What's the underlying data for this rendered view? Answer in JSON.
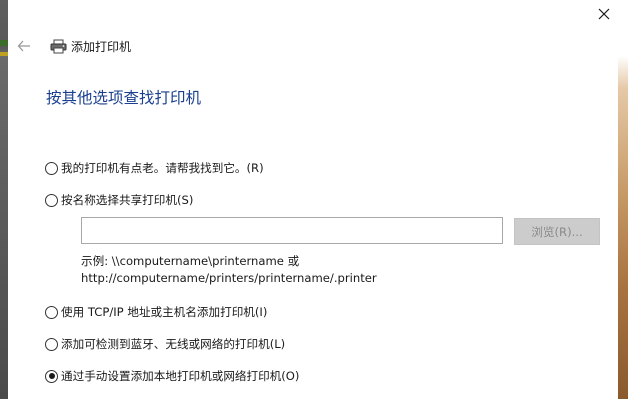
{
  "window": {
    "title": "添加打印机",
    "close_icon": "close-icon",
    "back_icon": "back-arrow-icon",
    "printer_icon": "printer-icon"
  },
  "main": {
    "heading": "按其他选项查找打印机",
    "options": [
      {
        "label": "我的打印机有点老。请帮我找到它。(R)",
        "checked": false
      },
      {
        "label": "按名称选择共享打印机(S)",
        "checked": false
      },
      {
        "label": "使用 TCP/IP 地址或主机名添加打印机(I)",
        "checked": false
      },
      {
        "label": "添加可检测到蓝牙、无线或网络的打印机(L)",
        "checked": false
      },
      {
        "label": "通过手动设置添加本地打印机或网络打印机(O)",
        "checked": true
      }
    ],
    "share_input": {
      "value": "",
      "placeholder": ""
    },
    "browse_label": "浏览(R)...",
    "example_line1": "示例: \\\\computername\\printername 或",
    "example_line2": "http://computername/printers/printername/.printer"
  },
  "colors": {
    "heading": "#1a3f8f",
    "button_disabled_bg": "#cccccc",
    "button_disabled_text": "#8a8a8a"
  }
}
